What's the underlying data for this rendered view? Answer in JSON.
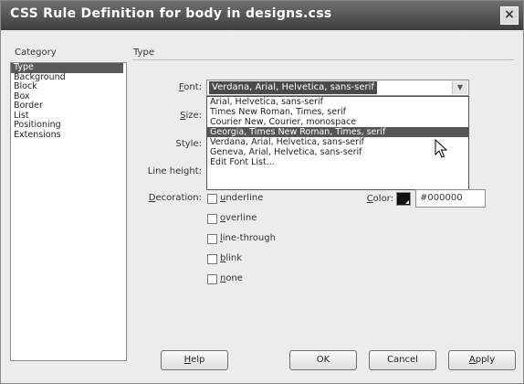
{
  "title": "CSS Rule Definition for body in designs.css",
  "close_glyph": "×",
  "category_header": "Category",
  "type_header": "Type",
  "categories": [
    "Type",
    "Background",
    "Block",
    "Box",
    "Border",
    "List",
    "Positioning",
    "Extensions"
  ],
  "selected_category": "Type",
  "font": {
    "label_hotkey": "F",
    "label_rest": "ont:",
    "value": "Verdana, Arial, Helvetica, sans-serif",
    "options": [
      "Arial, Helvetica, sans-serif",
      "Times New Roman, Times, serif",
      "Courier New, Courier, monospace",
      "Georgia, Times New Roman, Times, serif",
      "Verdana, Arial, Helvetica, sans-serif",
      "Geneva, Arial, Helvetica, sans-serif",
      "Edit Font List..."
    ],
    "highlighted_option": "Georgia, Times New Roman, Times, serif"
  },
  "size": {
    "hotkey": "S",
    "rest": "ize:"
  },
  "style": {
    "label": "Style:"
  },
  "line_height": {
    "label": "Line height:"
  },
  "decoration": {
    "hotkey": "D",
    "rest": "ecoration:",
    "options": [
      {
        "hotkey": "u",
        "rest": "nderline",
        "checked": false
      },
      {
        "hotkey": "o",
        "rest": "verline",
        "checked": false
      },
      {
        "hotkey": "l",
        "rest": "ine-through",
        "checked": false
      },
      {
        "hotkey": "b",
        "rest": "link",
        "checked": false
      },
      {
        "hotkey": "n",
        "rest": "one",
        "checked": false
      }
    ]
  },
  "color": {
    "hotkey": "C",
    "rest": "olor:",
    "value": "#000000",
    "swatch": "#000000"
  },
  "buttons": {
    "help": {
      "hotkey": "H",
      "rest": "elp"
    },
    "ok": {
      "label": "OK"
    },
    "cancel": {
      "label": "Cancel"
    },
    "apply": {
      "hotkey": "A",
      "rest": "pply"
    }
  },
  "icons": {
    "dropdown_arrow": "chevron-down-icon",
    "cursor": "mouse-pointer-icon"
  }
}
